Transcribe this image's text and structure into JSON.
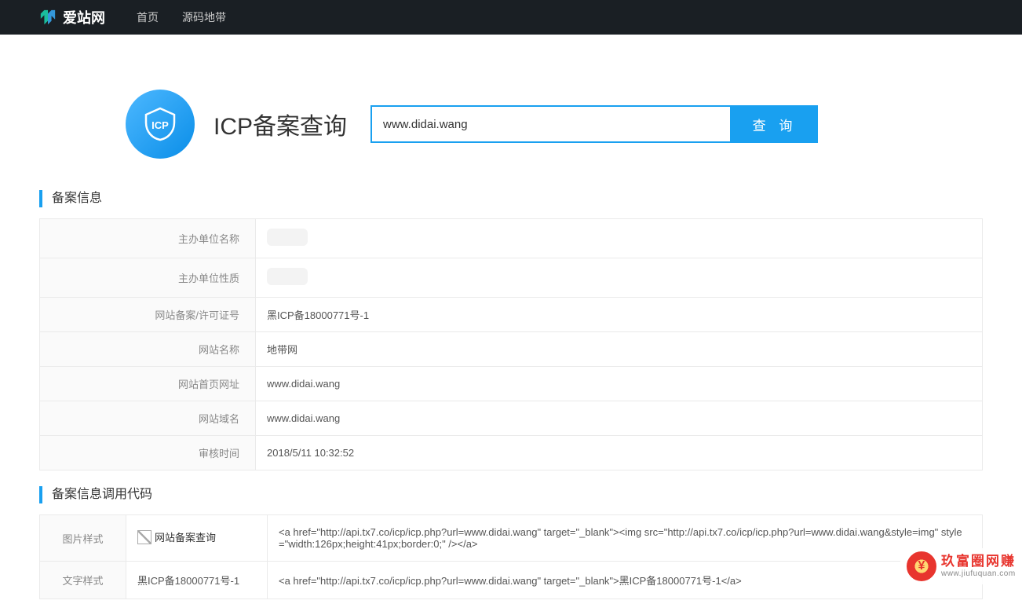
{
  "nav": {
    "brand": "爱站网",
    "items": [
      "首页",
      "源码地带"
    ]
  },
  "hero": {
    "title": "ICP备案查询",
    "badge_text": "ICP",
    "search_value": "www.didai.wang",
    "search_btn": "查 询"
  },
  "info_section": {
    "title": "备案信息",
    "rows": [
      {
        "label": "主办单位名称",
        "value": ""
      },
      {
        "label": "主办单位性质",
        "value": ""
      },
      {
        "label": "网站备案/许可证号",
        "value": "黑ICP备18000771号-1"
      },
      {
        "label": "网站名称",
        "value": "地带网"
      },
      {
        "label": "网站首页网址",
        "value": "www.didai.wang"
      },
      {
        "label": "网站域名",
        "value": "www.didai.wang"
      },
      {
        "label": "审核时间",
        "value": "2018/5/11 10:32:52"
      }
    ]
  },
  "code_section": {
    "title": "备案信息调用代码",
    "rows": [
      {
        "label": "图片样式",
        "preview_alt": "网站备案查询",
        "code": "<a href=\"http://api.tx7.co/icp/icp.php?url=www.didai.wang\" target=\"_blank\"><img src=\"http://api.tx7.co/icp/icp.php?url=www.didai.wang&style=img\" style=\"width:126px;height:41px;border:0;\" /></a>"
      },
      {
        "label": "文字样式",
        "preview_text": "黑ICP备18000771号-1",
        "code": "<a href=\"http://api.tx7.co/icp/icp.php?url=www.didai.wang\" target=\"_blank\">黑ICP备18000771号-1</a>"
      }
    ]
  },
  "watermark": {
    "badge": "¥",
    "cn": "玖富圈网赚",
    "url": "www.jiufuquan.com"
  }
}
